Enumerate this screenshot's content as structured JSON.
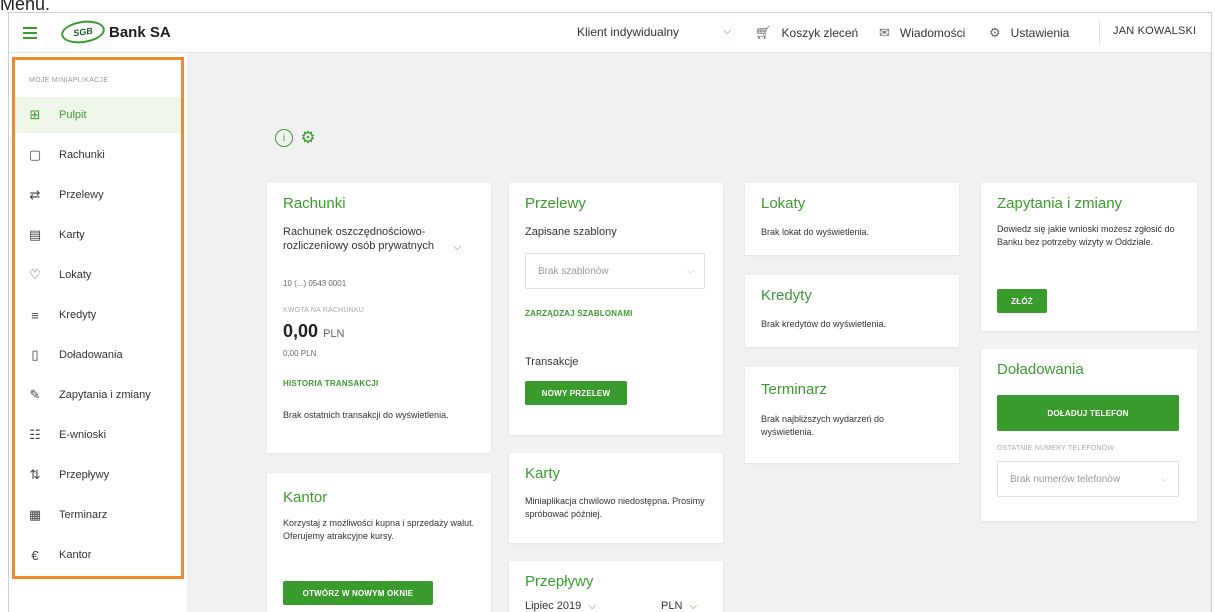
{
  "caption": "Menu.",
  "header": {
    "logo_badge": "SGB",
    "logo_text": "Bank SA",
    "client_type": "Klient indywidualny",
    "cart": "Koszyk zleceń",
    "messages": "Wiadomości",
    "settings": "Ustawienia",
    "user": "JAN KOWALSKI"
  },
  "sidebar": {
    "heading": "MOJE MINIAPLIKACJE",
    "items": [
      {
        "label": "Pulpit",
        "icon": "dashboard-icon"
      },
      {
        "label": "Rachunki",
        "icon": "wallet-icon"
      },
      {
        "label": "Przelewy",
        "icon": "transfer-icon"
      },
      {
        "label": "Karty",
        "icon": "card-icon"
      },
      {
        "label": "Lokaty",
        "icon": "deposit-icon"
      },
      {
        "label": "Kredyty",
        "icon": "credit-icon"
      },
      {
        "label": "Doładowania",
        "icon": "phone-icon"
      },
      {
        "label": "Zapytania i zmiany",
        "icon": "edit-document-icon"
      },
      {
        "label": "E-wnioski",
        "icon": "eapplication-icon"
      },
      {
        "label": "Przepływy",
        "icon": "cashflow-icon"
      },
      {
        "label": "Terminarz",
        "icon": "calendar-icon"
      },
      {
        "label": "Kantor",
        "icon": "exchange-icon"
      }
    ]
  },
  "cards": {
    "rachunki": {
      "title": "Rachunki",
      "account_name": "Rachunek oszczędnościowo-rozliczeniowy osób prywatnych",
      "account_number": "10 (...) 0543 0001",
      "balance_label": "KWOTA NA RACHUNKU",
      "balance_amount": "0,00",
      "balance_currency": "PLN",
      "available": "0,00 PLN",
      "history_link": "HISTORIA TRANSAKCJI",
      "no_transactions": "Brak ostatnich transakcji do wyświetlenia."
    },
    "kantor": {
      "title": "Kantor",
      "text": "Korzystaj z możliwości kupna i sprzedaży walut. Oferujemy atrakcyjne kursy.",
      "button": "OTWÓRZ W NOWYM OKNIE"
    },
    "przelewy": {
      "title": "Przelewy",
      "templates_label": "Zapisane szablony",
      "templates_placeholder": "Brak szablonów",
      "manage_link": "ZARZĄDZAJ SZABLONAMI",
      "transactions_label": "Transakcje",
      "new_transfer": "NOWY PRZELEW"
    },
    "karty": {
      "title": "Karty",
      "text": "Miniaplikacja chwilowo niedostępna. Prosimy spróbować później."
    },
    "przeplywy": {
      "title": "Przepływy",
      "month": "Lipiec 2019",
      "currency": "PLN"
    },
    "lokaty": {
      "title": "Lokaty",
      "text": "Brak lokat do wyświetlenia."
    },
    "kredyty": {
      "title": "Kredyty",
      "text": "Brak kredytów do wyświetlenia."
    },
    "terminarz": {
      "title": "Terminarz",
      "text": "Brak najbliższych wydarzeń do wyświetlenia."
    },
    "zapytania": {
      "title": "Zapytania i zmiany",
      "text": "Dowiedz się jakie wnioski możesz zgłosić do Banku bez potrzeby wizyty w Oddziale.",
      "button": "ZŁÓŻ"
    },
    "doladowania": {
      "title": "Doładowania",
      "button": "DOŁADUJ TELEFON",
      "recent_label": "OSTATNIE NUMERY TELEFONÓW",
      "recent_placeholder": "Brak numerów telefonów"
    }
  },
  "colors": {
    "brand_green": "#3a9b2d",
    "highlight_orange": "#f08a2e"
  }
}
